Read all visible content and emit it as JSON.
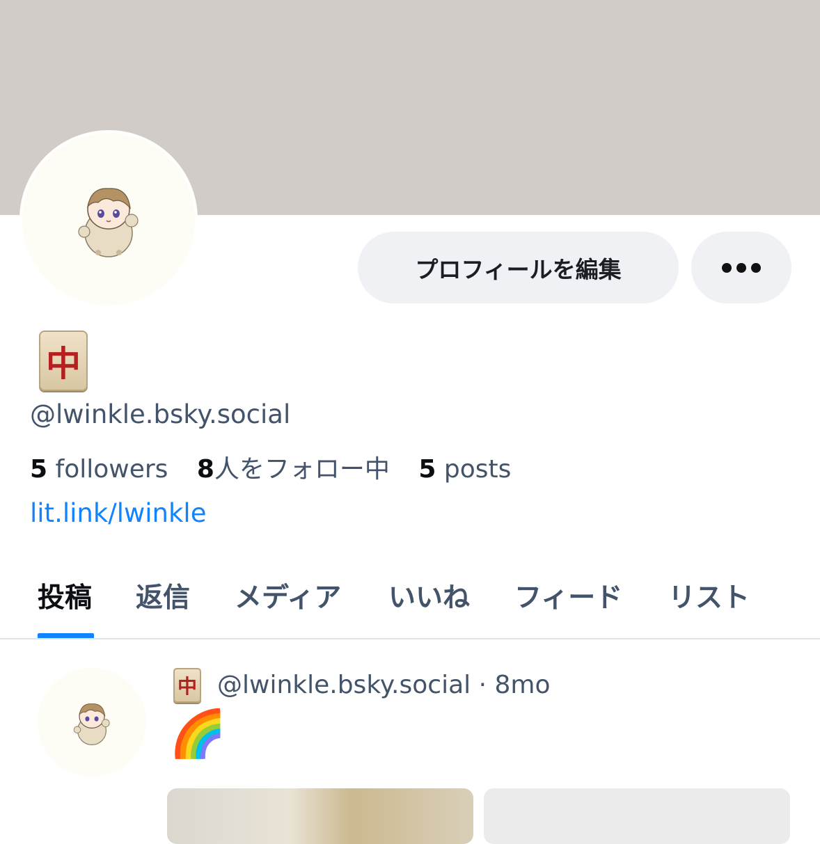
{
  "profile": {
    "display_name_icon": "mahjong-red-dragon-tile",
    "tile_glyph": "中",
    "handle": "@lwinkle.bsky.social",
    "link": "lit.link/lwinkle",
    "avatar_icon": "chibi-character-avatar"
  },
  "actions": {
    "edit_profile": "プロフィールを編集",
    "more_icon": "more-dots-icon"
  },
  "stats": {
    "followers_count": "5",
    "followers_label": "followers",
    "following_count": "8",
    "following_label": "人をフォロー中",
    "posts_count": "5",
    "posts_label": "posts"
  },
  "tabs": [
    {
      "label": "投稿",
      "active": true
    },
    {
      "label": "返信",
      "active": false
    },
    {
      "label": "メディア",
      "active": false
    },
    {
      "label": "いいね",
      "active": false
    },
    {
      "label": "フィード",
      "active": false
    },
    {
      "label": "リスト",
      "active": false
    }
  ],
  "post": {
    "author_handle": "@lwinkle.bsky.social",
    "separator": "·",
    "time": "8mo",
    "text": "🌈",
    "images": [
      "image-1",
      "image-2"
    ]
  },
  "colors": {
    "banner": "#d1ccc8",
    "accent": "#1083fe",
    "muted_text": "#42536a",
    "pill_bg": "#eff1f5"
  }
}
